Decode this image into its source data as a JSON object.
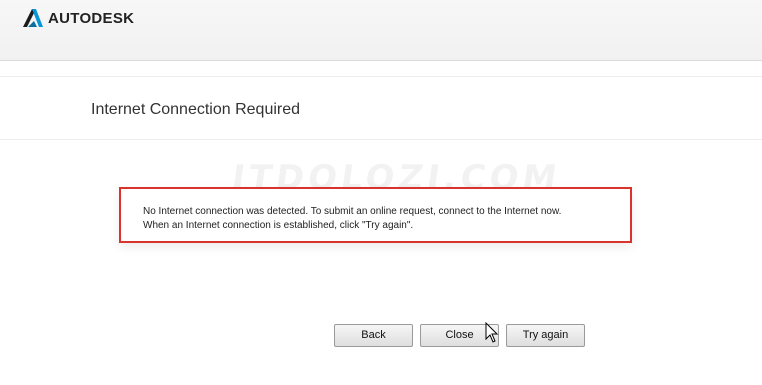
{
  "header": {
    "brand": "AUTODESK"
  },
  "page": {
    "title": "Internet Connection Required"
  },
  "watermark": {
    "text": "ITDOLOZI.COM"
  },
  "message": {
    "line1": "No Internet connection was detected. To submit an online request, connect to the Internet now.",
    "line2": "When an Internet connection is established, click \"Try again\"."
  },
  "buttons": {
    "back": "Back",
    "close": "Close",
    "try_again": "Try again"
  },
  "colors": {
    "highlight_border": "#d9332b",
    "logo_accent": "#0696d7"
  },
  "icons": {
    "logo": "autodesk-logo-icon",
    "cursor": "mouse-pointer-icon"
  }
}
